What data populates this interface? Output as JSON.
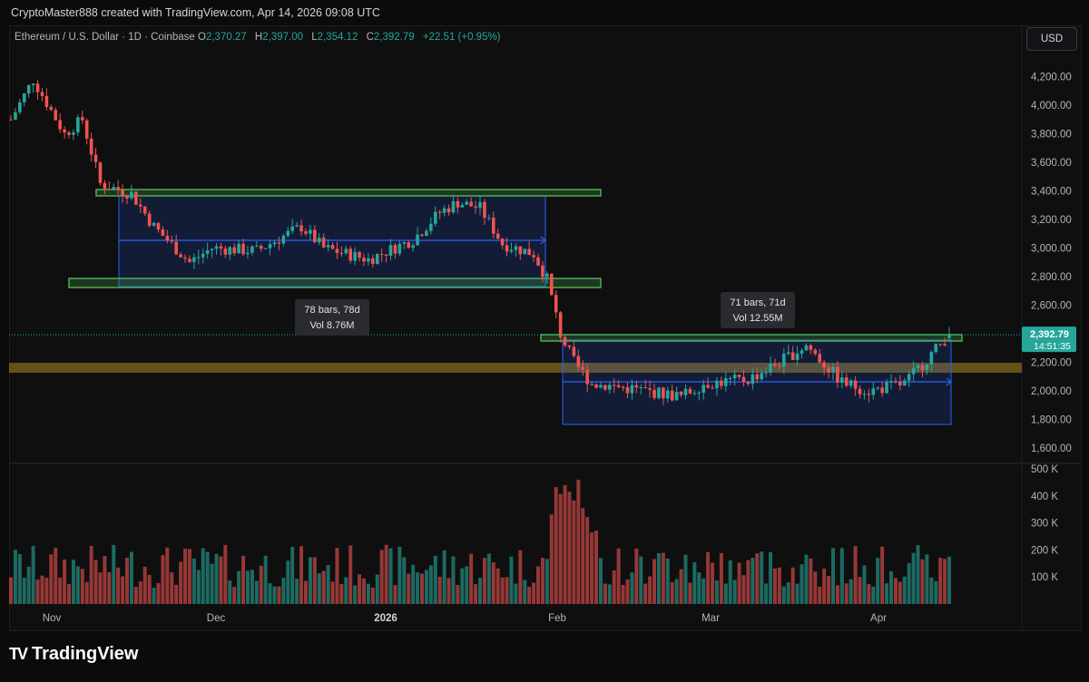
{
  "header": {
    "title": "CryptoMaster888 created with TradingView.com, Apr 14, 2026 09:08 UTC"
  },
  "symbol": {
    "name": "Ethereum / U.S. Dollar · 1D · Coinbase",
    "o_label": "O",
    "o_value": "2,370.27",
    "h_label": "H",
    "h_value": "2,397.00",
    "l_label": "L",
    "l_value": "2,354.12",
    "c_label": "C",
    "c_value": "2,392.79",
    "change": "+22.51 (+0.95%)"
  },
  "currency_button": "USD",
  "price_axis_labels": [
    "4,200.00",
    "4,000.00",
    "3,800.00",
    "3,600.00",
    "3,400.00",
    "3,200.00",
    "3,000.00",
    "2,800.00",
    "2,600.00",
    "2,200.00",
    "2,000.00",
    "1,800.00",
    "1,600.00"
  ],
  "current_price": {
    "price": "2,392.79",
    "countdown": "14:51:35"
  },
  "volume_axis_labels": [
    "500 K",
    "400 K",
    "300 K",
    "200 K",
    "100 K"
  ],
  "time_axis_labels": [
    "Nov",
    "Dec",
    "2026",
    "Feb",
    "Mar",
    "Apr"
  ],
  "annotations": [
    {
      "line1": "78 bars, 78d",
      "line2": "Vol 8.76M"
    },
    {
      "line1": "71 bars, 71d",
      "line2": "Vol 12.55M"
    }
  ],
  "colors": {
    "up": "#26a69a",
    "down": "#ef5350",
    "zone_green": "#4caf50",
    "range_box": "#2962ff",
    "support_band": "#c9a227"
  },
  "footer": {
    "brand": "TradingView",
    "logo_mark": "TV"
  },
  "chart_data": {
    "type": "candlestick",
    "instrument": "Ethereum / U.S. Dollar",
    "interval": "1D",
    "exchange": "Coinbase",
    "ylim": [
      1600,
      4300
    ],
    "last_close": 2392.79,
    "candles": []
  }
}
